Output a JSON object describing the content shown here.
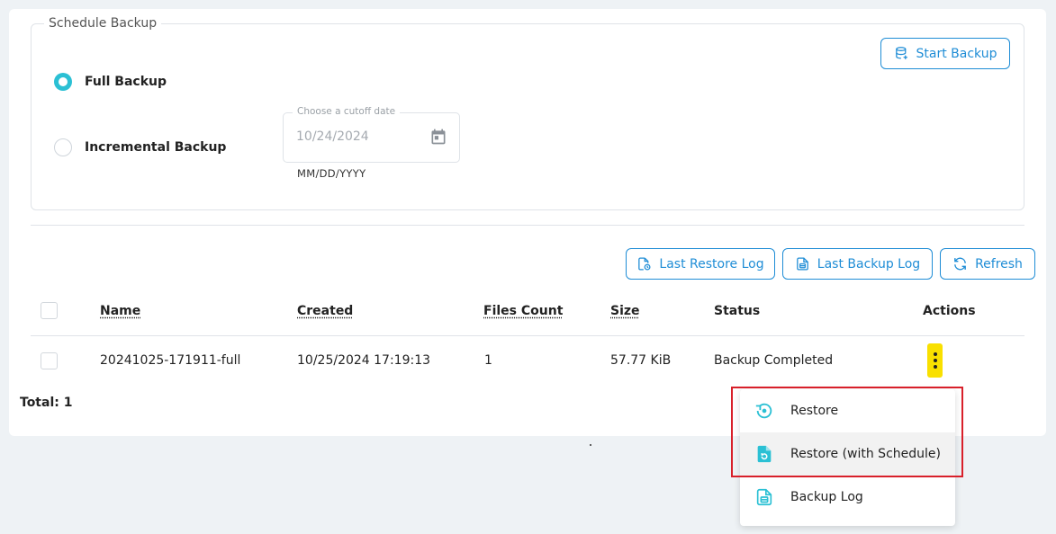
{
  "schedule": {
    "legend": "Schedule Backup",
    "full_backup_label": "Full Backup",
    "incremental_backup_label": "Incremental Backup",
    "date_label": "Choose a cutoff date",
    "date_value": "10/24/2024",
    "date_help": "MM/DD/YYYY",
    "start_backup_label": "Start Backup",
    "selected": "full"
  },
  "toolbar": {
    "last_restore_log_label": "Last Restore Log",
    "last_backup_log_label": "Last Backup Log",
    "refresh_label": "Refresh"
  },
  "table": {
    "headers": {
      "name": "Name",
      "created": "Created",
      "files_count": "Files Count",
      "size": "Size",
      "status": "Status",
      "actions": "Actions"
    },
    "rows": [
      {
        "name": "20241025-171911-full",
        "created": "10/25/2024 17:19:13",
        "files_count": "1",
        "size": "57.77 KiB",
        "status": "Backup Completed"
      }
    ],
    "total_label": "Total: 1"
  },
  "actions_menu": {
    "items": [
      {
        "label": "Restore",
        "icon": "restore-icon"
      },
      {
        "label": "Restore (with Schedule)",
        "icon": "restore-schedule-icon"
      },
      {
        "label": "Backup Log",
        "icon": "log-file-icon"
      }
    ]
  },
  "colors": {
    "accent": "#1f8dd6",
    "radio_selected": "#2bc0d4",
    "menu_icon": "#2bc0d4",
    "highlight": "#d8202a",
    "kebab_highlight": "#f9e000"
  }
}
